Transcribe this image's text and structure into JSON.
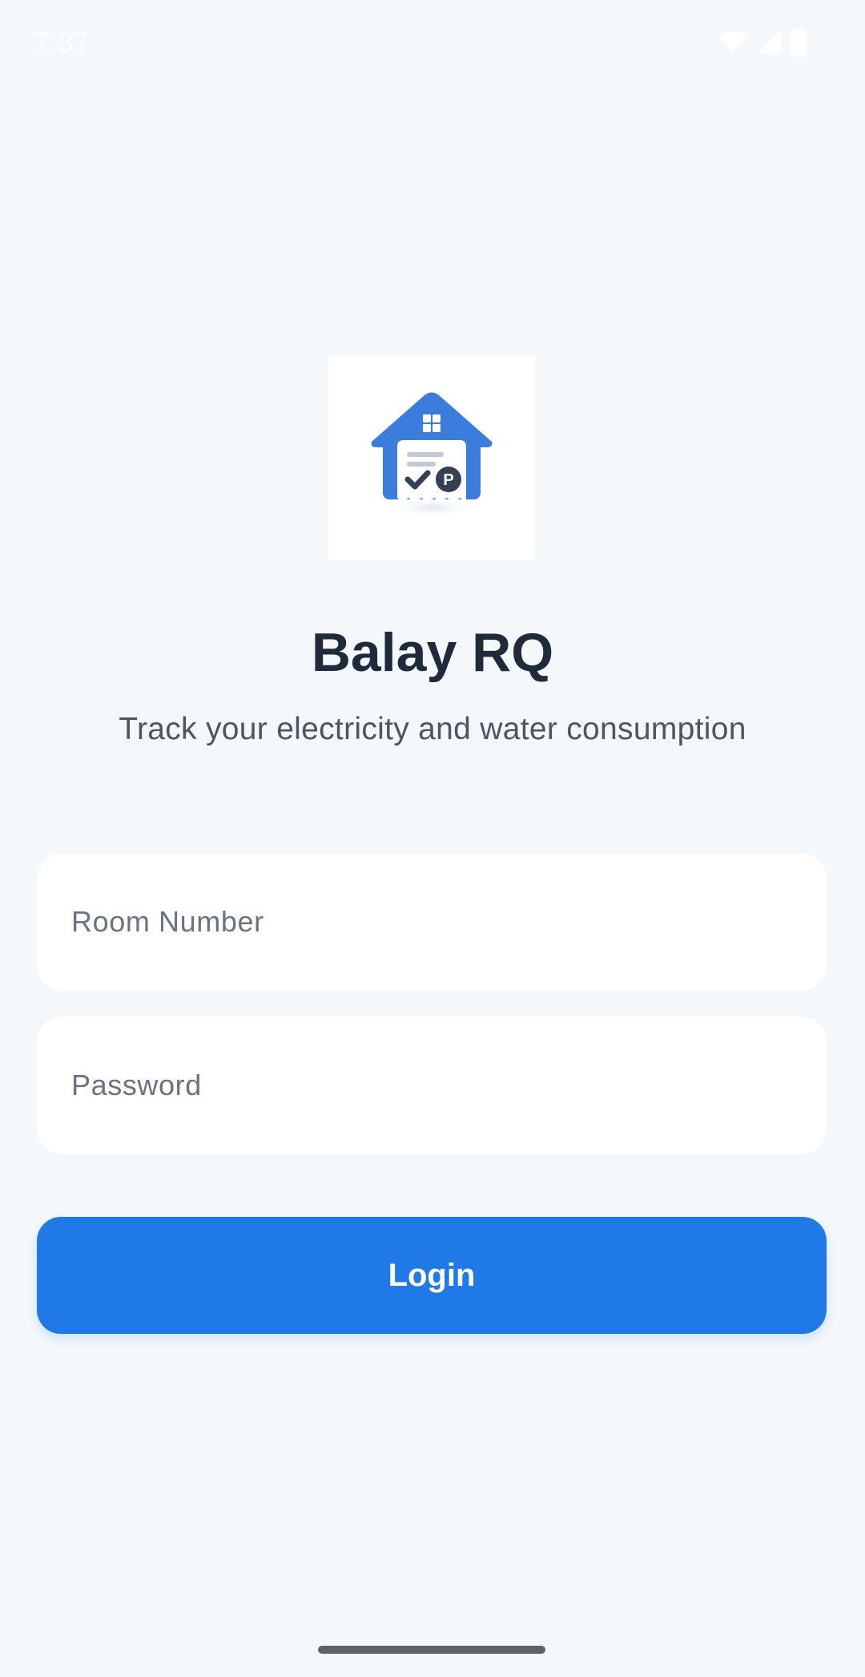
{
  "status_bar": {
    "time": "7:37",
    "icons": [
      "wifi-icon",
      "cell-signal-icon",
      "battery-icon"
    ]
  },
  "logo": {
    "icon": "house-receipt-icon",
    "badge_letter": "P",
    "colors": {
      "primary": "#3b7ddd",
      "dark": "#334155"
    }
  },
  "header": {
    "title": "Balay RQ",
    "subtitle": "Track your electricity and water consumption"
  },
  "form": {
    "room_number": {
      "placeholder": "Room Number",
      "value": ""
    },
    "password": {
      "placeholder": "Password",
      "value": ""
    },
    "login_label": "Login"
  },
  "colors": {
    "background": "#f5f8fb",
    "accent": "#1f7ae8",
    "title": "#1f2a3a",
    "subtitle": "#4b5563"
  }
}
